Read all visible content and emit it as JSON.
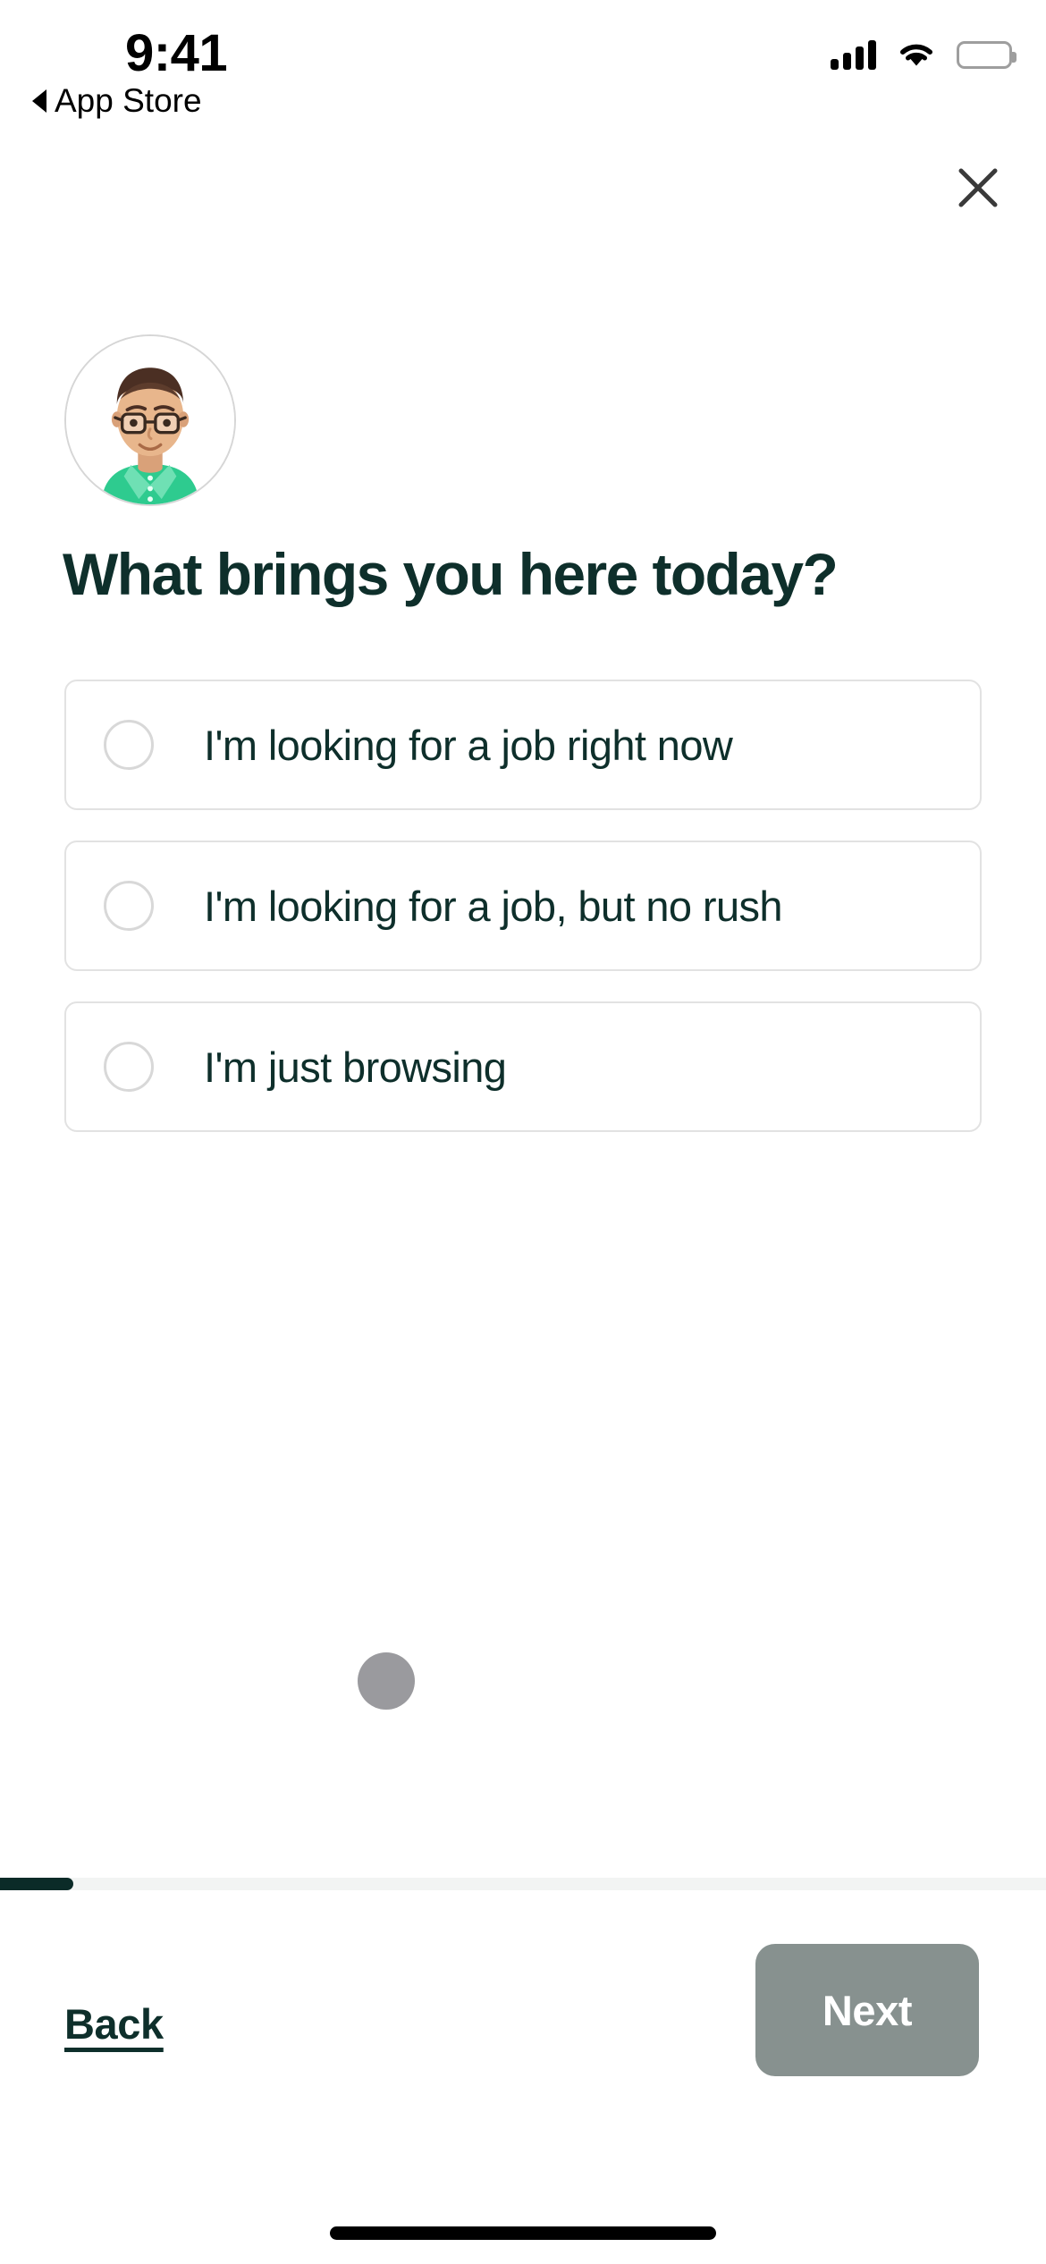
{
  "status_bar": {
    "time": "9:41",
    "back_label": "App Store",
    "back_icon": "triangle-left-icon",
    "signal_icon": "cellular-signal-icon",
    "signal_bars": 4,
    "wifi_icon": "wifi-icon",
    "battery_icon": "battery-full-icon"
  },
  "header": {
    "close_icon": "close-x-icon"
  },
  "avatar": {
    "name": "user-avatar-illustration",
    "alt": "Illustrated man with brown hair, glasses and green polo shirt"
  },
  "main": {
    "heading": "What brings you here today?",
    "options": [
      {
        "label": "I'm looking for a job right now",
        "selected": false
      },
      {
        "label": "I'm looking for a job, but no rush",
        "selected": false
      },
      {
        "label": "I'm just browsing",
        "selected": false
      }
    ],
    "loading_indicator": "loading-dot"
  },
  "progress": {
    "percent": 7,
    "fill_color": "#0b2b28",
    "track_color": "#f2f4f3"
  },
  "footer": {
    "back_label": "Back",
    "next_label": "Next",
    "next_disabled": true,
    "next_color": "#87918f"
  },
  "colors": {
    "brand_dark_green": "#0e2f2b",
    "card_border": "#e2e2e2",
    "radio_border": "#d8d8d8",
    "avatar_shirt_green": "#3fd49a",
    "loading_dot_gray": "#9a9a9e"
  }
}
